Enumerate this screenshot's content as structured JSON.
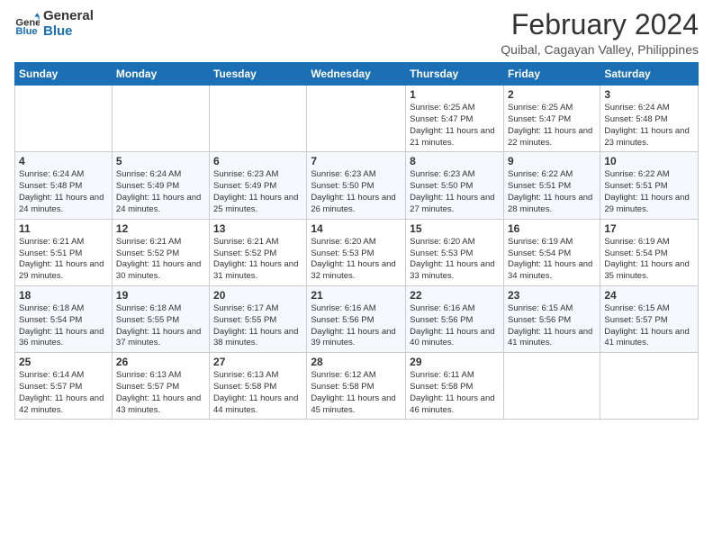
{
  "logo": {
    "line1": "General",
    "line2": "Blue"
  },
  "title": "February 2024",
  "location": "Quibal, Cagayan Valley, Philippines",
  "days_of_week": [
    "Sunday",
    "Monday",
    "Tuesday",
    "Wednesday",
    "Thursday",
    "Friday",
    "Saturday"
  ],
  "weeks": [
    [
      {
        "day": "",
        "info": ""
      },
      {
        "day": "",
        "info": ""
      },
      {
        "day": "",
        "info": ""
      },
      {
        "day": "",
        "info": ""
      },
      {
        "day": "1",
        "info": "Sunrise: 6:25 AM\nSunset: 5:47 PM\nDaylight: 11 hours and 21 minutes."
      },
      {
        "day": "2",
        "info": "Sunrise: 6:25 AM\nSunset: 5:47 PM\nDaylight: 11 hours and 22 minutes."
      },
      {
        "day": "3",
        "info": "Sunrise: 6:24 AM\nSunset: 5:48 PM\nDaylight: 11 hours and 23 minutes."
      }
    ],
    [
      {
        "day": "4",
        "info": "Sunrise: 6:24 AM\nSunset: 5:48 PM\nDaylight: 11 hours and 24 minutes."
      },
      {
        "day": "5",
        "info": "Sunrise: 6:24 AM\nSunset: 5:49 PM\nDaylight: 11 hours and 24 minutes."
      },
      {
        "day": "6",
        "info": "Sunrise: 6:23 AM\nSunset: 5:49 PM\nDaylight: 11 hours and 25 minutes."
      },
      {
        "day": "7",
        "info": "Sunrise: 6:23 AM\nSunset: 5:50 PM\nDaylight: 11 hours and 26 minutes."
      },
      {
        "day": "8",
        "info": "Sunrise: 6:23 AM\nSunset: 5:50 PM\nDaylight: 11 hours and 27 minutes."
      },
      {
        "day": "9",
        "info": "Sunrise: 6:22 AM\nSunset: 5:51 PM\nDaylight: 11 hours and 28 minutes."
      },
      {
        "day": "10",
        "info": "Sunrise: 6:22 AM\nSunset: 5:51 PM\nDaylight: 11 hours and 29 minutes."
      }
    ],
    [
      {
        "day": "11",
        "info": "Sunrise: 6:21 AM\nSunset: 5:51 PM\nDaylight: 11 hours and 29 minutes."
      },
      {
        "day": "12",
        "info": "Sunrise: 6:21 AM\nSunset: 5:52 PM\nDaylight: 11 hours and 30 minutes."
      },
      {
        "day": "13",
        "info": "Sunrise: 6:21 AM\nSunset: 5:52 PM\nDaylight: 11 hours and 31 minutes."
      },
      {
        "day": "14",
        "info": "Sunrise: 6:20 AM\nSunset: 5:53 PM\nDaylight: 11 hours and 32 minutes."
      },
      {
        "day": "15",
        "info": "Sunrise: 6:20 AM\nSunset: 5:53 PM\nDaylight: 11 hours and 33 minutes."
      },
      {
        "day": "16",
        "info": "Sunrise: 6:19 AM\nSunset: 5:54 PM\nDaylight: 11 hours and 34 minutes."
      },
      {
        "day": "17",
        "info": "Sunrise: 6:19 AM\nSunset: 5:54 PM\nDaylight: 11 hours and 35 minutes."
      }
    ],
    [
      {
        "day": "18",
        "info": "Sunrise: 6:18 AM\nSunset: 5:54 PM\nDaylight: 11 hours and 36 minutes."
      },
      {
        "day": "19",
        "info": "Sunrise: 6:18 AM\nSunset: 5:55 PM\nDaylight: 11 hours and 37 minutes."
      },
      {
        "day": "20",
        "info": "Sunrise: 6:17 AM\nSunset: 5:55 PM\nDaylight: 11 hours and 38 minutes."
      },
      {
        "day": "21",
        "info": "Sunrise: 6:16 AM\nSunset: 5:56 PM\nDaylight: 11 hours and 39 minutes."
      },
      {
        "day": "22",
        "info": "Sunrise: 6:16 AM\nSunset: 5:56 PM\nDaylight: 11 hours and 40 minutes."
      },
      {
        "day": "23",
        "info": "Sunrise: 6:15 AM\nSunset: 5:56 PM\nDaylight: 11 hours and 41 minutes."
      },
      {
        "day": "24",
        "info": "Sunrise: 6:15 AM\nSunset: 5:57 PM\nDaylight: 11 hours and 41 minutes."
      }
    ],
    [
      {
        "day": "25",
        "info": "Sunrise: 6:14 AM\nSunset: 5:57 PM\nDaylight: 11 hours and 42 minutes."
      },
      {
        "day": "26",
        "info": "Sunrise: 6:13 AM\nSunset: 5:57 PM\nDaylight: 11 hours and 43 minutes."
      },
      {
        "day": "27",
        "info": "Sunrise: 6:13 AM\nSunset: 5:58 PM\nDaylight: 11 hours and 44 minutes."
      },
      {
        "day": "28",
        "info": "Sunrise: 6:12 AM\nSunset: 5:58 PM\nDaylight: 11 hours and 45 minutes."
      },
      {
        "day": "29",
        "info": "Sunrise: 6:11 AM\nSunset: 5:58 PM\nDaylight: 11 hours and 46 minutes."
      },
      {
        "day": "",
        "info": ""
      },
      {
        "day": "",
        "info": ""
      }
    ]
  ]
}
